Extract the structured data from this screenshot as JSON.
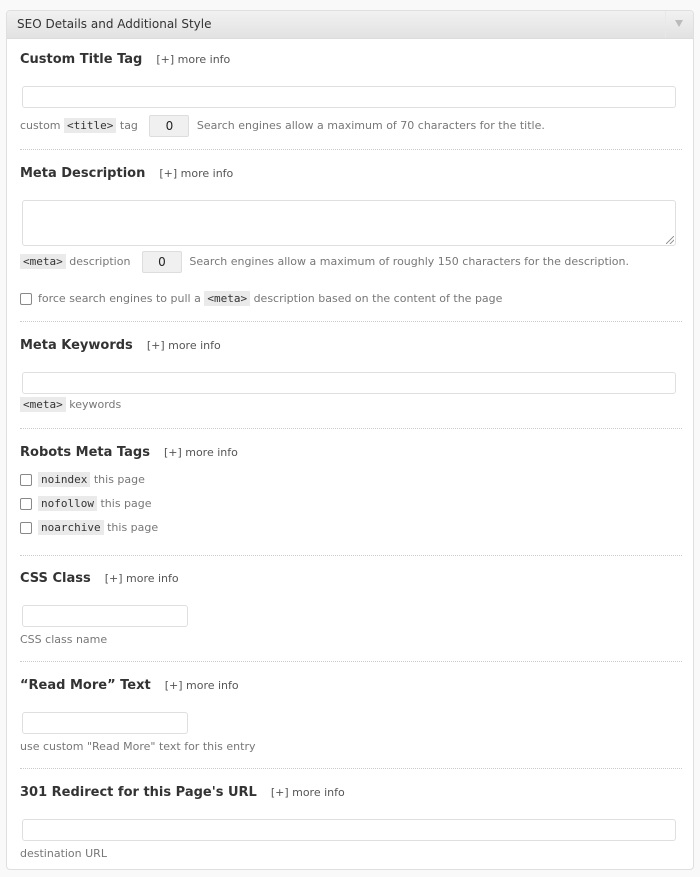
{
  "panel": {
    "title": "SEO Details and Additional Style",
    "toggle_icon": "triangle-down-icon"
  },
  "more_info": "[+] more info",
  "title_tag": {
    "label": "Custom Title Tag",
    "value": "",
    "help_prefix": "custom",
    "code": "<title>",
    "help_mid": "tag",
    "count": "0",
    "limit_text": "Search engines allow a maximum of 70 characters for the title."
  },
  "meta_description": {
    "label": "Meta Description",
    "value": "",
    "code": "<meta>",
    "help_mid": "description",
    "count": "0",
    "limit_text": "Search engines allow a maximum of roughly 150 characters for the description.",
    "force_prefix": "force search engines to pull a",
    "force_code": "<meta>",
    "force_suffix": "description based on the content of the page",
    "force_checked": false
  },
  "meta_keywords": {
    "label": "Meta Keywords",
    "value": "",
    "code": "<meta>",
    "help": "keywords"
  },
  "robots": {
    "label": "Robots Meta Tags",
    "items": [
      {
        "code": "noindex",
        "text": "this page",
        "checked": false
      },
      {
        "code": "nofollow",
        "text": "this page",
        "checked": false
      },
      {
        "code": "noarchive",
        "text": "this page",
        "checked": false
      }
    ]
  },
  "css_class": {
    "label": "CSS Class",
    "value": "",
    "help": "CSS class name"
  },
  "read_more": {
    "label": "“Read More” Text",
    "value": "",
    "help": "use custom \"Read More\" text for this entry"
  },
  "redirect": {
    "label": "301 Redirect for this Page's URL",
    "value": "",
    "help": "destination URL"
  }
}
